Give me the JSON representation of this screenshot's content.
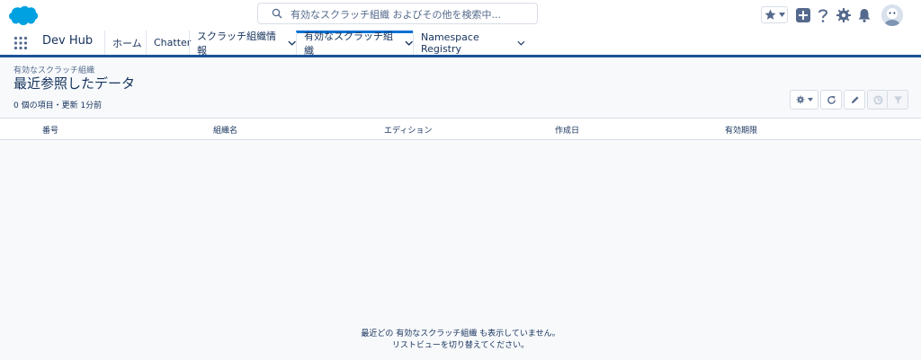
{
  "search": {
    "placeholder": "有効なスクラッチ組織 およびその他を検索中..."
  },
  "app": {
    "name": "Dev Hub"
  },
  "nav": {
    "items": [
      {
        "label": "ホーム"
      },
      {
        "label": "Chatter"
      },
      {
        "label": "スクラッチ組織情報"
      },
      {
        "label": "有効なスクラッチ組織"
      },
      {
        "label": "Namespace Registry"
      }
    ]
  },
  "header": {
    "object_label": "有効なスクラッチ組織",
    "list_view_name": "最近参照したデータ",
    "meta": "0 個の項目・更新 1分前"
  },
  "table": {
    "columns": [
      "番号",
      "組織名",
      "エディション",
      "作成日",
      "有効期限"
    ]
  },
  "empty_state": {
    "line1": "最近どの 有効なスクラッチ組織 も表示していません。",
    "line2": "リストビューを切り替えてください。"
  },
  "colors": {
    "brand": "#1b5297",
    "accent": "#0070d2",
    "text": "#16325c",
    "icon": "#54698d",
    "cloud": "#00a1e0"
  },
  "icons": {
    "logo": "salesforce-cloud-logo",
    "search": "search-icon",
    "favorite": "star-icon",
    "add": "plus-icon",
    "help": "question-icon",
    "setup": "gear-icon",
    "notifications": "bell-icon",
    "launcher": "app-launcher-icon",
    "settings": "gear-icon",
    "refresh": "refresh-icon",
    "edit": "pencil-icon",
    "chart": "chart-icon",
    "filter": "filter-icon"
  }
}
